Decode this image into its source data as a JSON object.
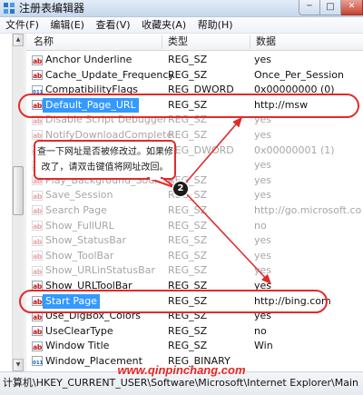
{
  "window": {
    "title": "注册表编辑器"
  },
  "menu": [
    {
      "label": "文件(F)"
    },
    {
      "label": "编辑(E)"
    },
    {
      "label": "查看(V)"
    },
    {
      "label": "收藏夹(A)"
    },
    {
      "label": "帮助(H)"
    }
  ],
  "columns": {
    "name": "名称",
    "type": "类型",
    "data": "数据"
  },
  "rows": [
    {
      "name": "Anchor Underline",
      "type": "REG_SZ",
      "data": "yes",
      "icon": "string-value-icon",
      "dimmed": false,
      "selected": false
    },
    {
      "name": "Cache_Update_Frequency",
      "type": "REG_SZ",
      "data": "Once_Per_Session",
      "icon": "string-value-icon",
      "dimmed": false,
      "selected": false
    },
    {
      "name": "CompatibilityFlags",
      "type": "REG_DWORD",
      "data": "0x00000000 (0)",
      "icon": "binary-value-icon",
      "dimmed": false,
      "selected": false
    },
    {
      "name": "Default_Page_URL",
      "type": "REG_SZ",
      "data": "http://msw",
      "icon": "string-value-icon",
      "dimmed": false,
      "selected": true
    },
    {
      "name": "Disable Script Debugger",
      "type": "REG_SZ",
      "data": "yes",
      "icon": "string-value-icon",
      "dimmed": true,
      "selected": false
    },
    {
      "name": "NotifyDownloadComplete",
      "type": "REG_SZ",
      "data": "yes",
      "icon": "string-value-icon",
      "dimmed": true,
      "selected": false
    },
    {
      "name": "",
      "type": "REG_DWORD",
      "data": "0x00000001 (1)",
      "icon": "binary-value-icon",
      "dimmed": true,
      "selected": false
    },
    {
      "name": "",
      "type": "",
      "data": "yes",
      "icon": "string-value-icon",
      "dimmed": true,
      "selected": false
    },
    {
      "name": "Play_Background_Sounds",
      "type": "REG_SZ",
      "data": "yes",
      "icon": "string-value-icon",
      "dimmed": true,
      "selected": false
    },
    {
      "name": "Save_Session",
      "type": "REG_SZ",
      "data": "yes",
      "icon": "string-value-icon",
      "dimmed": true,
      "selected": false
    },
    {
      "name": "Search Page",
      "type": "REG_SZ",
      "data": "http://go.microsoft.co",
      "icon": "string-value-icon",
      "dimmed": true,
      "selected": false
    },
    {
      "name": "Show_FullURL",
      "type": "REG_SZ",
      "data": "no",
      "icon": "string-value-icon",
      "dimmed": true,
      "selected": false
    },
    {
      "name": "Show_StatusBar",
      "type": "REG_SZ",
      "data": "yes",
      "icon": "string-value-icon",
      "dimmed": true,
      "selected": false
    },
    {
      "name": "Show_ToolBar",
      "type": "REG_SZ",
      "data": "yes",
      "icon": "string-value-icon",
      "dimmed": true,
      "selected": false
    },
    {
      "name": "Show_URLinStatusBar",
      "type": "REG_SZ",
      "data": "yes",
      "icon": "string-value-icon",
      "dimmed": true,
      "selected": false
    },
    {
      "name": "Show_URLToolBar",
      "type": "REG_SZ",
      "data": "yes",
      "icon": "string-value-icon",
      "dimmed": false,
      "selected": false
    },
    {
      "name": "Start Page",
      "type": "REG_SZ",
      "data": "http://bing.com",
      "icon": "string-value-icon",
      "dimmed": false,
      "selected": true
    },
    {
      "name": "Use_DlgBox_Colors",
      "type": "REG_SZ",
      "data": "yes",
      "icon": "string-value-icon",
      "dimmed": false,
      "selected": false
    },
    {
      "name": "UseClearType",
      "type": "REG_SZ",
      "data": "no",
      "icon": "string-value-icon",
      "dimmed": false,
      "selected": false
    },
    {
      "name": "Window Title",
      "type": "REG_SZ",
      "data": "Win",
      "icon": "string-value-icon",
      "dimmed": false,
      "selected": false
    },
    {
      "name": "Window_Placement",
      "type": "REG_BINARY",
      "data": "",
      "icon": "binary-value-icon",
      "dimmed": false,
      "selected": false
    }
  ],
  "callout": {
    "lines": [
      "查一下网址是否被修改过。如果修",
      "改了，请双击键值将网址改回。"
    ]
  },
  "badge": {
    "label": "2"
  },
  "status": {
    "path": "计算机\\HKEY_CURRENT_USER\\Software\\Microsoft\\Internet Explorer\\Main"
  },
  "watermark": {
    "text": "www.qinpinchang.com"
  },
  "colors": {
    "selection": "#3399ff",
    "annotation": "#e02b2b",
    "watermark": "#e8231f"
  }
}
